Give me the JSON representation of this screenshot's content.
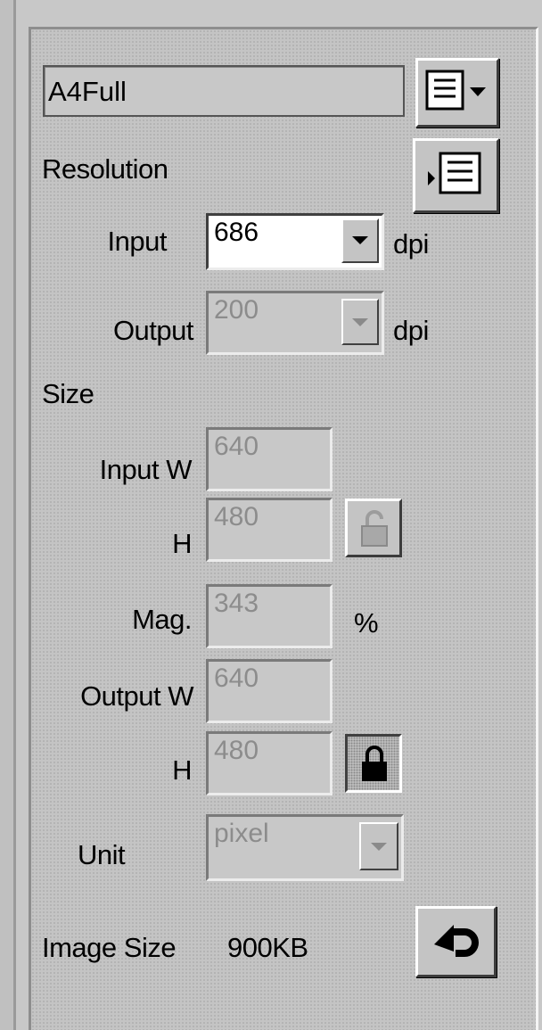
{
  "preset": {
    "name": "A4Full",
    "menu_icon": "list-menu-icon"
  },
  "resolution": {
    "title": "Resolution",
    "expand_icon": "expand-list-icon",
    "input_label": "Input",
    "input_value": "686",
    "input_unit": "dpi",
    "output_label": "Output",
    "output_value": "200",
    "output_unit": "dpi"
  },
  "size": {
    "title": "Size",
    "input_w_label": "Input W",
    "input_w_value": "640",
    "input_h_label": "H",
    "input_h_value": "480",
    "input_lock_icon": "unlocked-padlock-icon",
    "mag_label": "Mag.",
    "mag_value": "343",
    "mag_unit": "%",
    "output_w_label": "Output W",
    "output_w_value": "640",
    "output_h_label": "H",
    "output_h_value": "480",
    "output_lock_icon": "locked-padlock-icon",
    "unit_label": "Unit",
    "unit_value": "pixel"
  },
  "image_size": {
    "label": "Image Size",
    "value": "900KB",
    "reset_icon": "undo-arrow-icon"
  }
}
